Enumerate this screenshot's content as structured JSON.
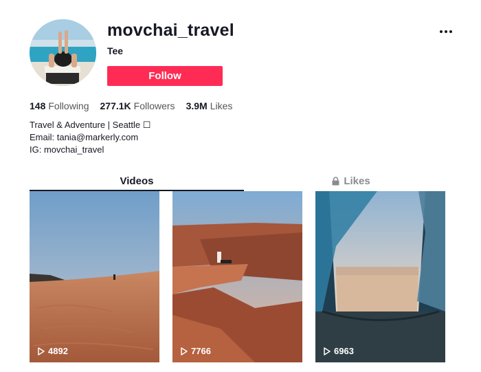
{
  "profile": {
    "username": "movchai_travel",
    "display_name": "Tee",
    "follow_label": "Follow"
  },
  "stats": {
    "following": {
      "count": "148",
      "label": "Following"
    },
    "followers": {
      "count": "277.1K",
      "label": "Followers"
    },
    "likes": {
      "count": "3.9M",
      "label": "Likes"
    }
  },
  "bio": {
    "line1": "Travel & Adventure | Seattle ☐",
    "line2": "Email: tania@markerly.com",
    "line3": "IG: movchai_travel"
  },
  "tabs": {
    "videos": "Videos",
    "likes": "Likes"
  },
  "videos": [
    {
      "views": "4892"
    },
    {
      "views": "7766"
    },
    {
      "views": "6963"
    }
  ],
  "colors": {
    "follow_button": "#fe2c55",
    "active_tab": "#161823",
    "inactive_tab": "#8a8b91"
  },
  "icons": {
    "more": "more-dots-icon",
    "lock": "lock-icon",
    "play": "play-icon"
  }
}
